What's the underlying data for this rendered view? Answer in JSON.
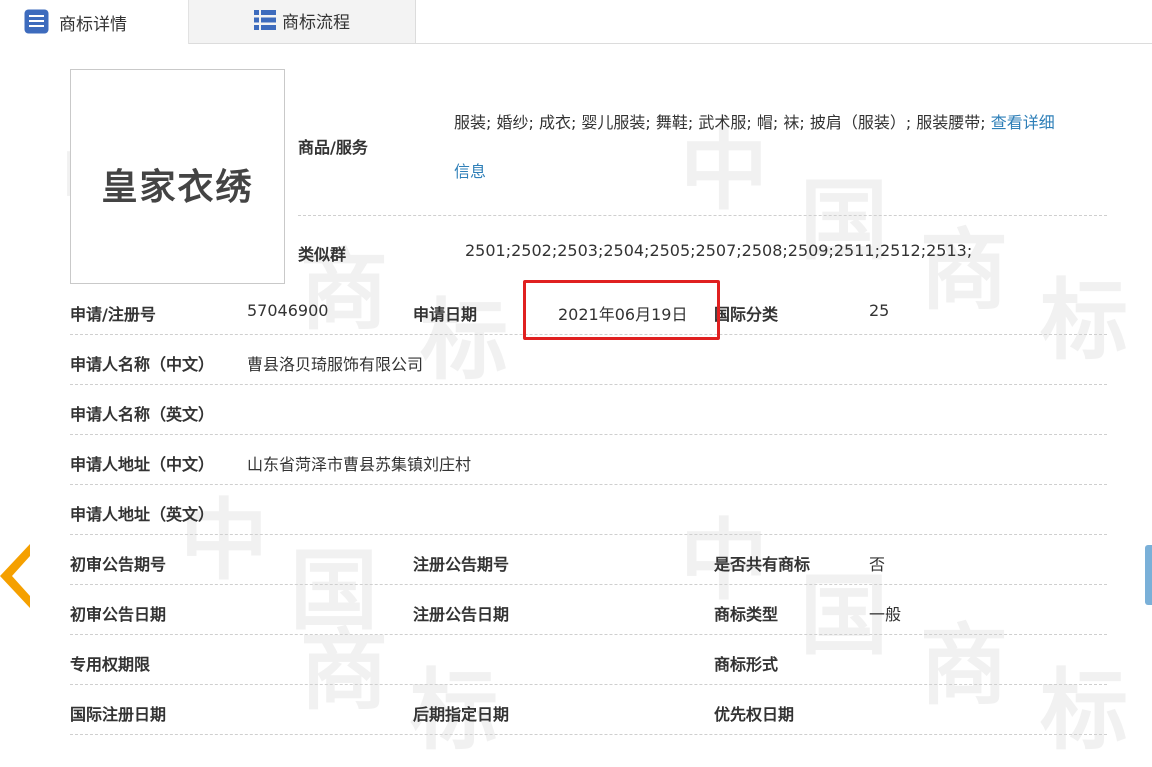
{
  "tabs": [
    {
      "label": "商标详情",
      "icon": "list-icon"
    },
    {
      "label": "商标流程",
      "icon": "grid-list-icon"
    }
  ],
  "watermark": [
    "中",
    "国",
    "商",
    "标"
  ],
  "logo_text": "皇家衣绣",
  "goods": {
    "label": "商品/服务",
    "value": "服装; 婚纱; 成衣; 婴儿服装; 舞鞋; 武术服; 帽; 袜; 披肩（服装）; 服装腰带; ",
    "link_part1": "查看详细",
    "link_part2": "信息"
  },
  "similar_group": {
    "label": "类似群",
    "value": "2501;2502;2503;2504;2505;2507;2508;2509;2511;2512;2513;"
  },
  "rows": {
    "reg_no": {
      "label": "申请/注册号",
      "value": "57046900"
    },
    "apply_date": {
      "label": "申请日期",
      "value": "2021年06月19日"
    },
    "intl_class": {
      "label": "国际分类",
      "value": "25"
    },
    "applicant_cn": {
      "label": "申请人名称（中文）",
      "value": "曹县洛贝琦服饰有限公司"
    },
    "applicant_en": {
      "label": "申请人名称（英文）",
      "value": ""
    },
    "address_cn": {
      "label": "申请人地址（中文）",
      "value": "山东省菏泽市曹县苏集镇刘庄村"
    },
    "address_en": {
      "label": "申请人地址（英文）",
      "value": ""
    },
    "prelim_no": {
      "label": "初审公告期号",
      "value": ""
    },
    "reg_pub_no": {
      "label": "注册公告期号",
      "value": ""
    },
    "shared": {
      "label": "是否共有商标",
      "value": "否"
    },
    "prelim_date": {
      "label": "初审公告日期",
      "value": ""
    },
    "reg_pub_date": {
      "label": "注册公告日期",
      "value": ""
    },
    "tm_type": {
      "label": "商标类型",
      "value": "一般"
    },
    "exclusive_term": {
      "label": "专用权期限",
      "value": ""
    },
    "tm_form": {
      "label": "商标形式",
      "value": ""
    },
    "intl_reg_date": {
      "label": "国际注册日期",
      "value": ""
    },
    "later_date": {
      "label": "后期指定日期",
      "value": ""
    },
    "priority_date": {
      "label": "优先权日期",
      "value": ""
    }
  },
  "colors": {
    "link": "#2e7fb8",
    "highlight": "#e02020",
    "arrow": "#f5a000"
  }
}
